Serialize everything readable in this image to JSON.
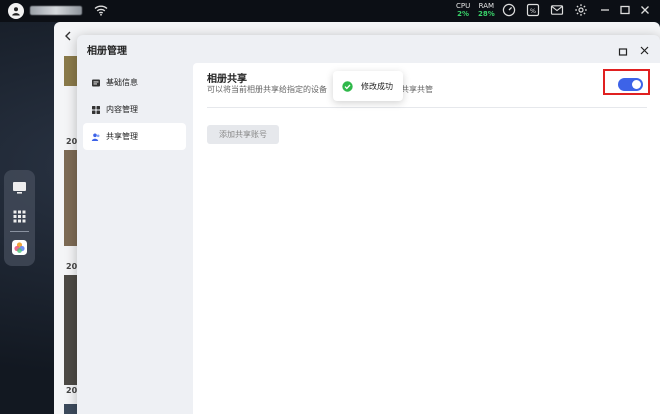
{
  "system_bar": {
    "cpu_label": "CPU",
    "cpu_value": "2%",
    "ram_label": "RAM",
    "ram_value": "28%",
    "icons": [
      "user-avatar-icon",
      "wifi-icon",
      "speedometer-icon",
      "resource-monitor-icon",
      "mail-icon",
      "gear-icon",
      "minimize-icon",
      "maximize-icon",
      "close-icon"
    ]
  },
  "dock": {
    "items": [
      "desktop-monitor-icon",
      "app-grid-icon",
      "photos-app-icon"
    ]
  },
  "photo_window": {
    "year_labels": [
      "20",
      "20",
      "20",
      "20"
    ]
  },
  "dialog": {
    "title": "相册管理",
    "nav": [
      {
        "label": "基础信息",
        "icon": "info-card-icon",
        "active": false
      },
      {
        "label": "内容管理",
        "icon": "grid-icon",
        "active": false
      },
      {
        "label": "共享管理",
        "icon": "share-users-icon",
        "active": true
      }
    ],
    "section": {
      "title": "相册共享",
      "description_left": "可以将当前相册共享给指定的设备",
      "description_right": "员共享共管",
      "toggle_on": true
    },
    "add_button_label": "添加共享账号"
  },
  "toast": {
    "message": "修改成功"
  },
  "colors": {
    "accent": "#3d63e8",
    "success": "#2fb84a",
    "highlight_box": "#e02020",
    "metric_green": "#39d26a"
  }
}
